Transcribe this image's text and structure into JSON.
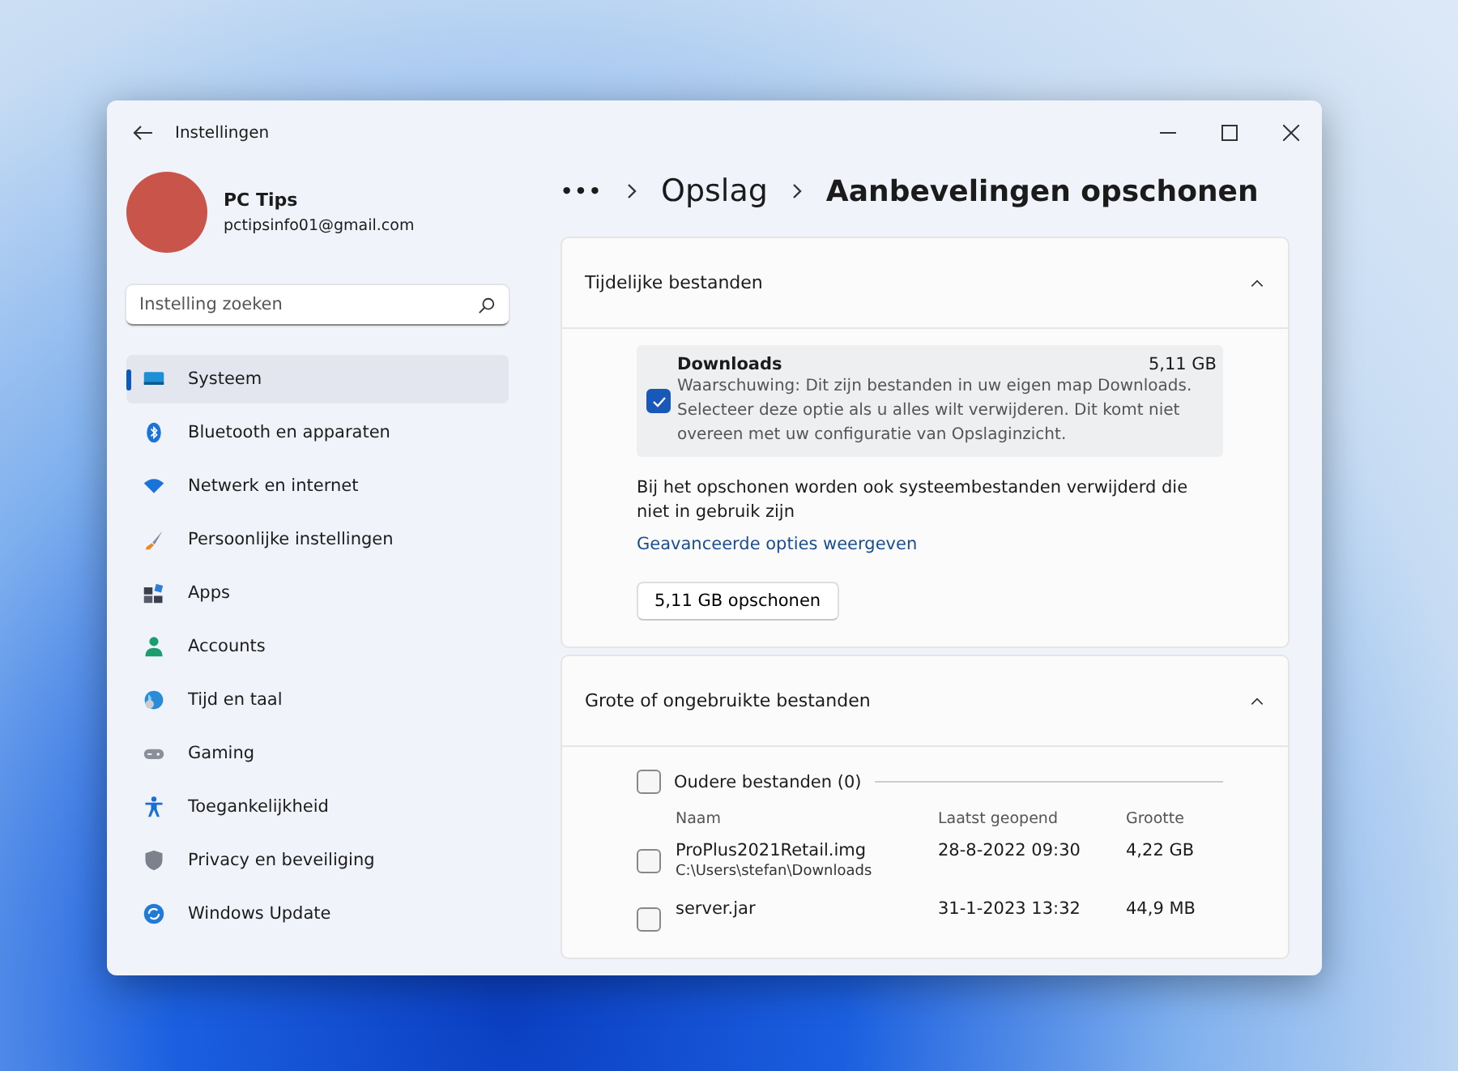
{
  "window": {
    "title": "Instellingen"
  },
  "account": {
    "name": "PC Tips",
    "email": "pctipsinfo01@gmail.com"
  },
  "search": {
    "placeholder": "Instelling zoeken"
  },
  "sidebar": {
    "items": [
      {
        "label": "Systeem",
        "selected": true
      },
      {
        "label": "Bluetooth en apparaten",
        "selected": false
      },
      {
        "label": "Netwerk en internet",
        "selected": false
      },
      {
        "label": "Persoonlijke instellingen",
        "selected": false
      },
      {
        "label": "Apps",
        "selected": false
      },
      {
        "label": "Accounts",
        "selected": false
      },
      {
        "label": "Tijd en taal",
        "selected": false
      },
      {
        "label": "Gaming",
        "selected": false
      },
      {
        "label": "Toegankelijkheid",
        "selected": false
      },
      {
        "label": "Privacy en beveiliging",
        "selected": false
      },
      {
        "label": "Windows Update",
        "selected": false
      }
    ]
  },
  "breadcrumb": {
    "more": "•••",
    "items": [
      "Opslag",
      "Aanbevelingen opschonen"
    ]
  },
  "sections": [
    {
      "title": "Tijdelijke bestanden",
      "expanded": true,
      "kind": "temp",
      "option": {
        "title": "Downloads",
        "size": "5,11 GB",
        "checked": true,
        "description": "Waarschuwing: Dit zijn bestanden in uw eigen map Downloads. Selecteer deze optie als u alles wilt verwijderen. Dit komt niet overeen met uw configuratie van Opslaginzicht."
      },
      "note": "Bij het opschonen worden ook systeembestanden verwijderd die niet in gebruik zijn",
      "link": "Geavanceerde opties weergeven",
      "button": "5,11 GB opschonen"
    },
    {
      "title": "Grote of ongebruikte bestanden",
      "expanded": true,
      "kind": "files",
      "group": {
        "label": "Oudere bestanden (0)",
        "checked": false
      },
      "columns": [
        "Naam",
        "Laatst geopend",
        "Grootte"
      ],
      "rows": [
        {
          "name": "ProPlus2021Retail.img",
          "path": "C:\\Users\\stefan\\Downloads",
          "opened": "28-8-2022 09:30",
          "size": "4,22 GB",
          "checked": false
        },
        {
          "name": "server.jar",
          "opened": "31-1-2023 13:32",
          "size": "44,9 MB",
          "checked": false
        }
      ]
    }
  ]
}
